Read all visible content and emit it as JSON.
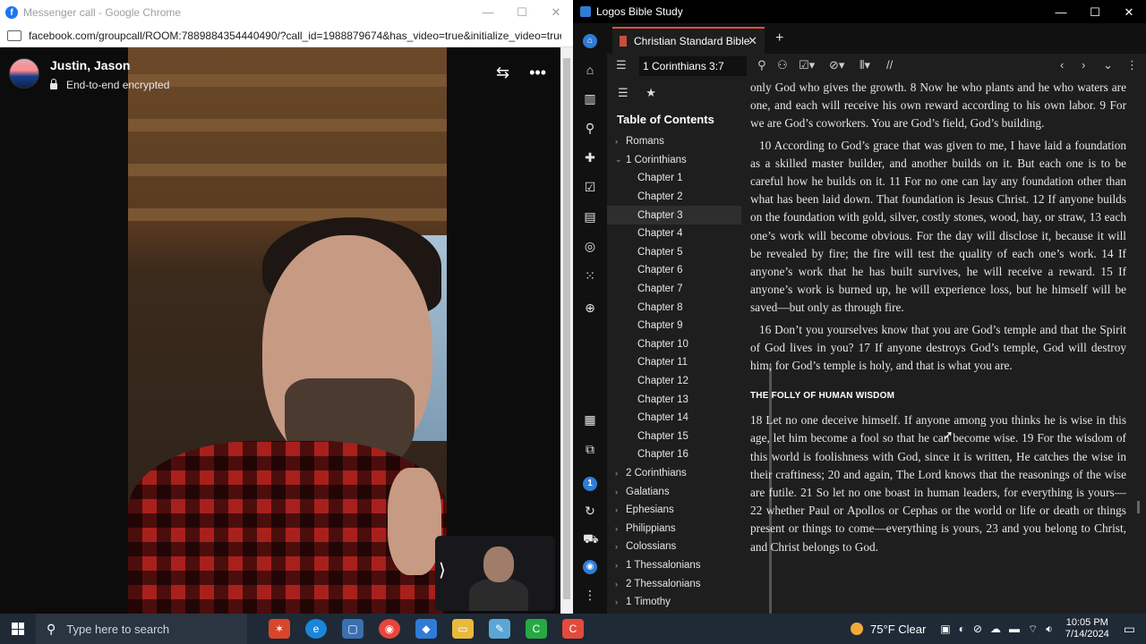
{
  "chrome": {
    "title": "Messenger call - Google Chrome",
    "url": "facebook.com/groupcall/ROOM:7889884354440490/?call_id=1988879674&has_video=true&initialize_video=true...",
    "caller_name": "Justin, Jason",
    "encryption": "End-to-end encrypted"
  },
  "logos": {
    "title": "Logos Bible Study",
    "tab_label": "Christian Standard Bible",
    "reference": "1 Corinthians 3:7",
    "toc_heading": "Table of Contents",
    "toc": [
      {
        "label": "Romans",
        "level": 0,
        "chev": "›"
      },
      {
        "label": "1 Corinthians",
        "level": 0,
        "chev": "⌄"
      },
      {
        "label": "Chapter 1",
        "level": 1
      },
      {
        "label": "Chapter 2",
        "level": 1
      },
      {
        "label": "Chapter 3",
        "level": 1,
        "selected": true
      },
      {
        "label": "Chapter 4",
        "level": 1
      },
      {
        "label": "Chapter 5",
        "level": 1
      },
      {
        "label": "Chapter 6",
        "level": 1
      },
      {
        "label": "Chapter 7",
        "level": 1
      },
      {
        "label": "Chapter 8",
        "level": 1
      },
      {
        "label": "Chapter 9",
        "level": 1
      },
      {
        "label": "Chapter 10",
        "level": 1
      },
      {
        "label": "Chapter 11",
        "level": 1
      },
      {
        "label": "Chapter 12",
        "level": 1
      },
      {
        "label": "Chapter 13",
        "level": 1
      },
      {
        "label": "Chapter 14",
        "level": 1
      },
      {
        "label": "Chapter 15",
        "level": 1
      },
      {
        "label": "Chapter 16",
        "level": 1
      },
      {
        "label": "2 Corinthians",
        "level": 0,
        "chev": "›"
      },
      {
        "label": "Galatians",
        "level": 0,
        "chev": "›"
      },
      {
        "label": "Ephesians",
        "level": 0,
        "chev": "›"
      },
      {
        "label": "Philippians",
        "level": 0,
        "chev": "›"
      },
      {
        "label": "Colossians",
        "level": 0,
        "chev": "›"
      },
      {
        "label": "1 Thessalonians",
        "level": 0,
        "chev": "›"
      },
      {
        "label": "2 Thessalonians",
        "level": 0,
        "chev": "›"
      },
      {
        "label": "1 Timothy",
        "level": 0,
        "chev": "›"
      }
    ],
    "text": {
      "p1": "only God who gives the growth. 8 Now he who plants and he who waters are one, and each will receive his own reward according to his own labor. 9 For we are God’s coworkers. You are God’s field, God’s building.",
      "p2": "10 According to God’s grace that was given to me, I have laid a foundation as a skilled master builder, and another builds on it. But each one is to be careful how he builds on it. 11 For no one can lay any foundation other than what has been laid down. That foundation is Jesus Christ. 12 If anyone builds on the foundation with gold, silver, costly stones, wood, hay, or straw, 13 each one’s work will become obvious. For the day will disclose it, because it will be revealed by fire; the fire will test the quality of each one’s work. 14 If anyone’s work that he has built survives, he will receive a reward. 15 If anyone’s work is burned up, he will experience loss, but he himself will be saved—but only as through fire.",
      "p3": "16 Don’t you yourselves know that you are God’s temple and that the Spirit of God lives in you? 17 If anyone destroys God’s temple, God will destroy him; for God’s temple is holy, and that is what you are.",
      "heading": "THE FOLLY OF HUMAN WISDOM",
      "p4": "18 Let no one deceive himself. If anyone among you thinks he is wise in this age, let him become a fool so that he can become wise. 19 For the wisdom of this world is foolishness with God, since it is written, He catches the wise in their craftiness; 20 and again, The Lord knows that the reasonings of the wise are futile. 21 So let no one boast in human leaders, for everything is yours— 22 whether Paul or Apollos or Cephas or the world or life or death or things present or things to come—everything is yours, 23 and you belong to Christ, and Christ belongs to God."
    }
  },
  "taskbar": {
    "search_placeholder": "Type here to search",
    "weather": "75°F  Clear",
    "time": "10:05 PM",
    "date": "7/14/2024"
  },
  "colors": {
    "accent_logos": "#2f7bd8",
    "tab_accent": "#e0533a",
    "facebook_blue": "#1877f2"
  }
}
